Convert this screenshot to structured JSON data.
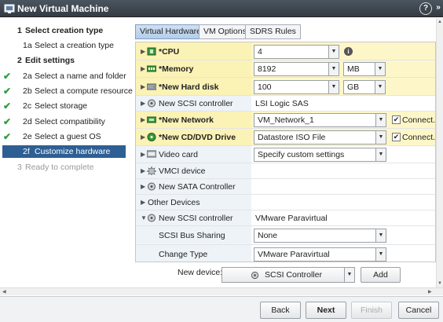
{
  "window": {
    "title": "New Virtual Machine",
    "help_label": "?",
    "menu_label": "»"
  },
  "steps": [
    {
      "num": "1",
      "label": "Select creation type",
      "state": "parent"
    },
    {
      "num": "1a",
      "label": "Select a creation type",
      "state": "current-group"
    },
    {
      "num": "2",
      "label": "Edit settings",
      "state": "parent"
    },
    {
      "num": "2a",
      "label": "Select a name and folder",
      "state": "done"
    },
    {
      "num": "2b",
      "label": "Select a compute resource",
      "state": "done"
    },
    {
      "num": "2c",
      "label": "Select storage",
      "state": "done"
    },
    {
      "num": "2d",
      "label": "Select compatibility",
      "state": "done"
    },
    {
      "num": "2e",
      "label": "Select a guest OS",
      "state": "done"
    },
    {
      "num": "2f",
      "label": "Customize hardware",
      "state": "active"
    },
    {
      "num": "3",
      "label": "Ready to complete",
      "state": "future"
    }
  ],
  "tabs": [
    {
      "label": "Virtual Hardware",
      "active": true
    },
    {
      "label": "VM Options",
      "active": false
    },
    {
      "label": "SDRS Rules",
      "active": false
    }
  ],
  "hardware": {
    "cpu": {
      "name": "*CPU",
      "value": "4",
      "icon": "cpu-icon"
    },
    "memory": {
      "name": "*Memory",
      "value": "8192",
      "unit": "MB",
      "icon": "memory-icon"
    },
    "hard_disk": {
      "name": "*New Hard disk",
      "value": "100",
      "unit": "GB",
      "icon": "hard-disk-icon"
    },
    "scsi_1": {
      "name": "New SCSI controller",
      "value": "LSI Logic SAS",
      "icon": "scsi-icon"
    },
    "network": {
      "name": "*New Network",
      "value": "VM_Network_1",
      "connect": "Connect...",
      "connected": true,
      "icon": "network-icon"
    },
    "cd": {
      "name": "*New CD/DVD Drive",
      "value": "Datastore ISO File",
      "connect": "Connect...",
      "connected": true,
      "icon": "cd-icon"
    },
    "video": {
      "name": "Video card",
      "value": "Specify custom settings",
      "icon": "video-card-icon"
    },
    "vmci": {
      "name": "VMCI device",
      "icon": "vmci-icon"
    },
    "sata": {
      "name": "New SATA Controller",
      "icon": "sata-icon"
    },
    "other": {
      "name": "Other Devices"
    },
    "scsi_2": {
      "name": "New SCSI controller",
      "value": "VMware Paravirtual",
      "icon": "scsi-icon"
    },
    "bus_sharing": {
      "name": "SCSI Bus Sharing",
      "value": "None"
    },
    "change_type": {
      "name": "Change Type",
      "value": "VMware Paravirtual"
    }
  },
  "new_device": {
    "label": "New device:",
    "selected": "SCSI Controller",
    "add_label": "Add"
  },
  "footer": {
    "back": "Back",
    "next": "Next",
    "finish": "Finish",
    "cancel": "Cancel"
  }
}
